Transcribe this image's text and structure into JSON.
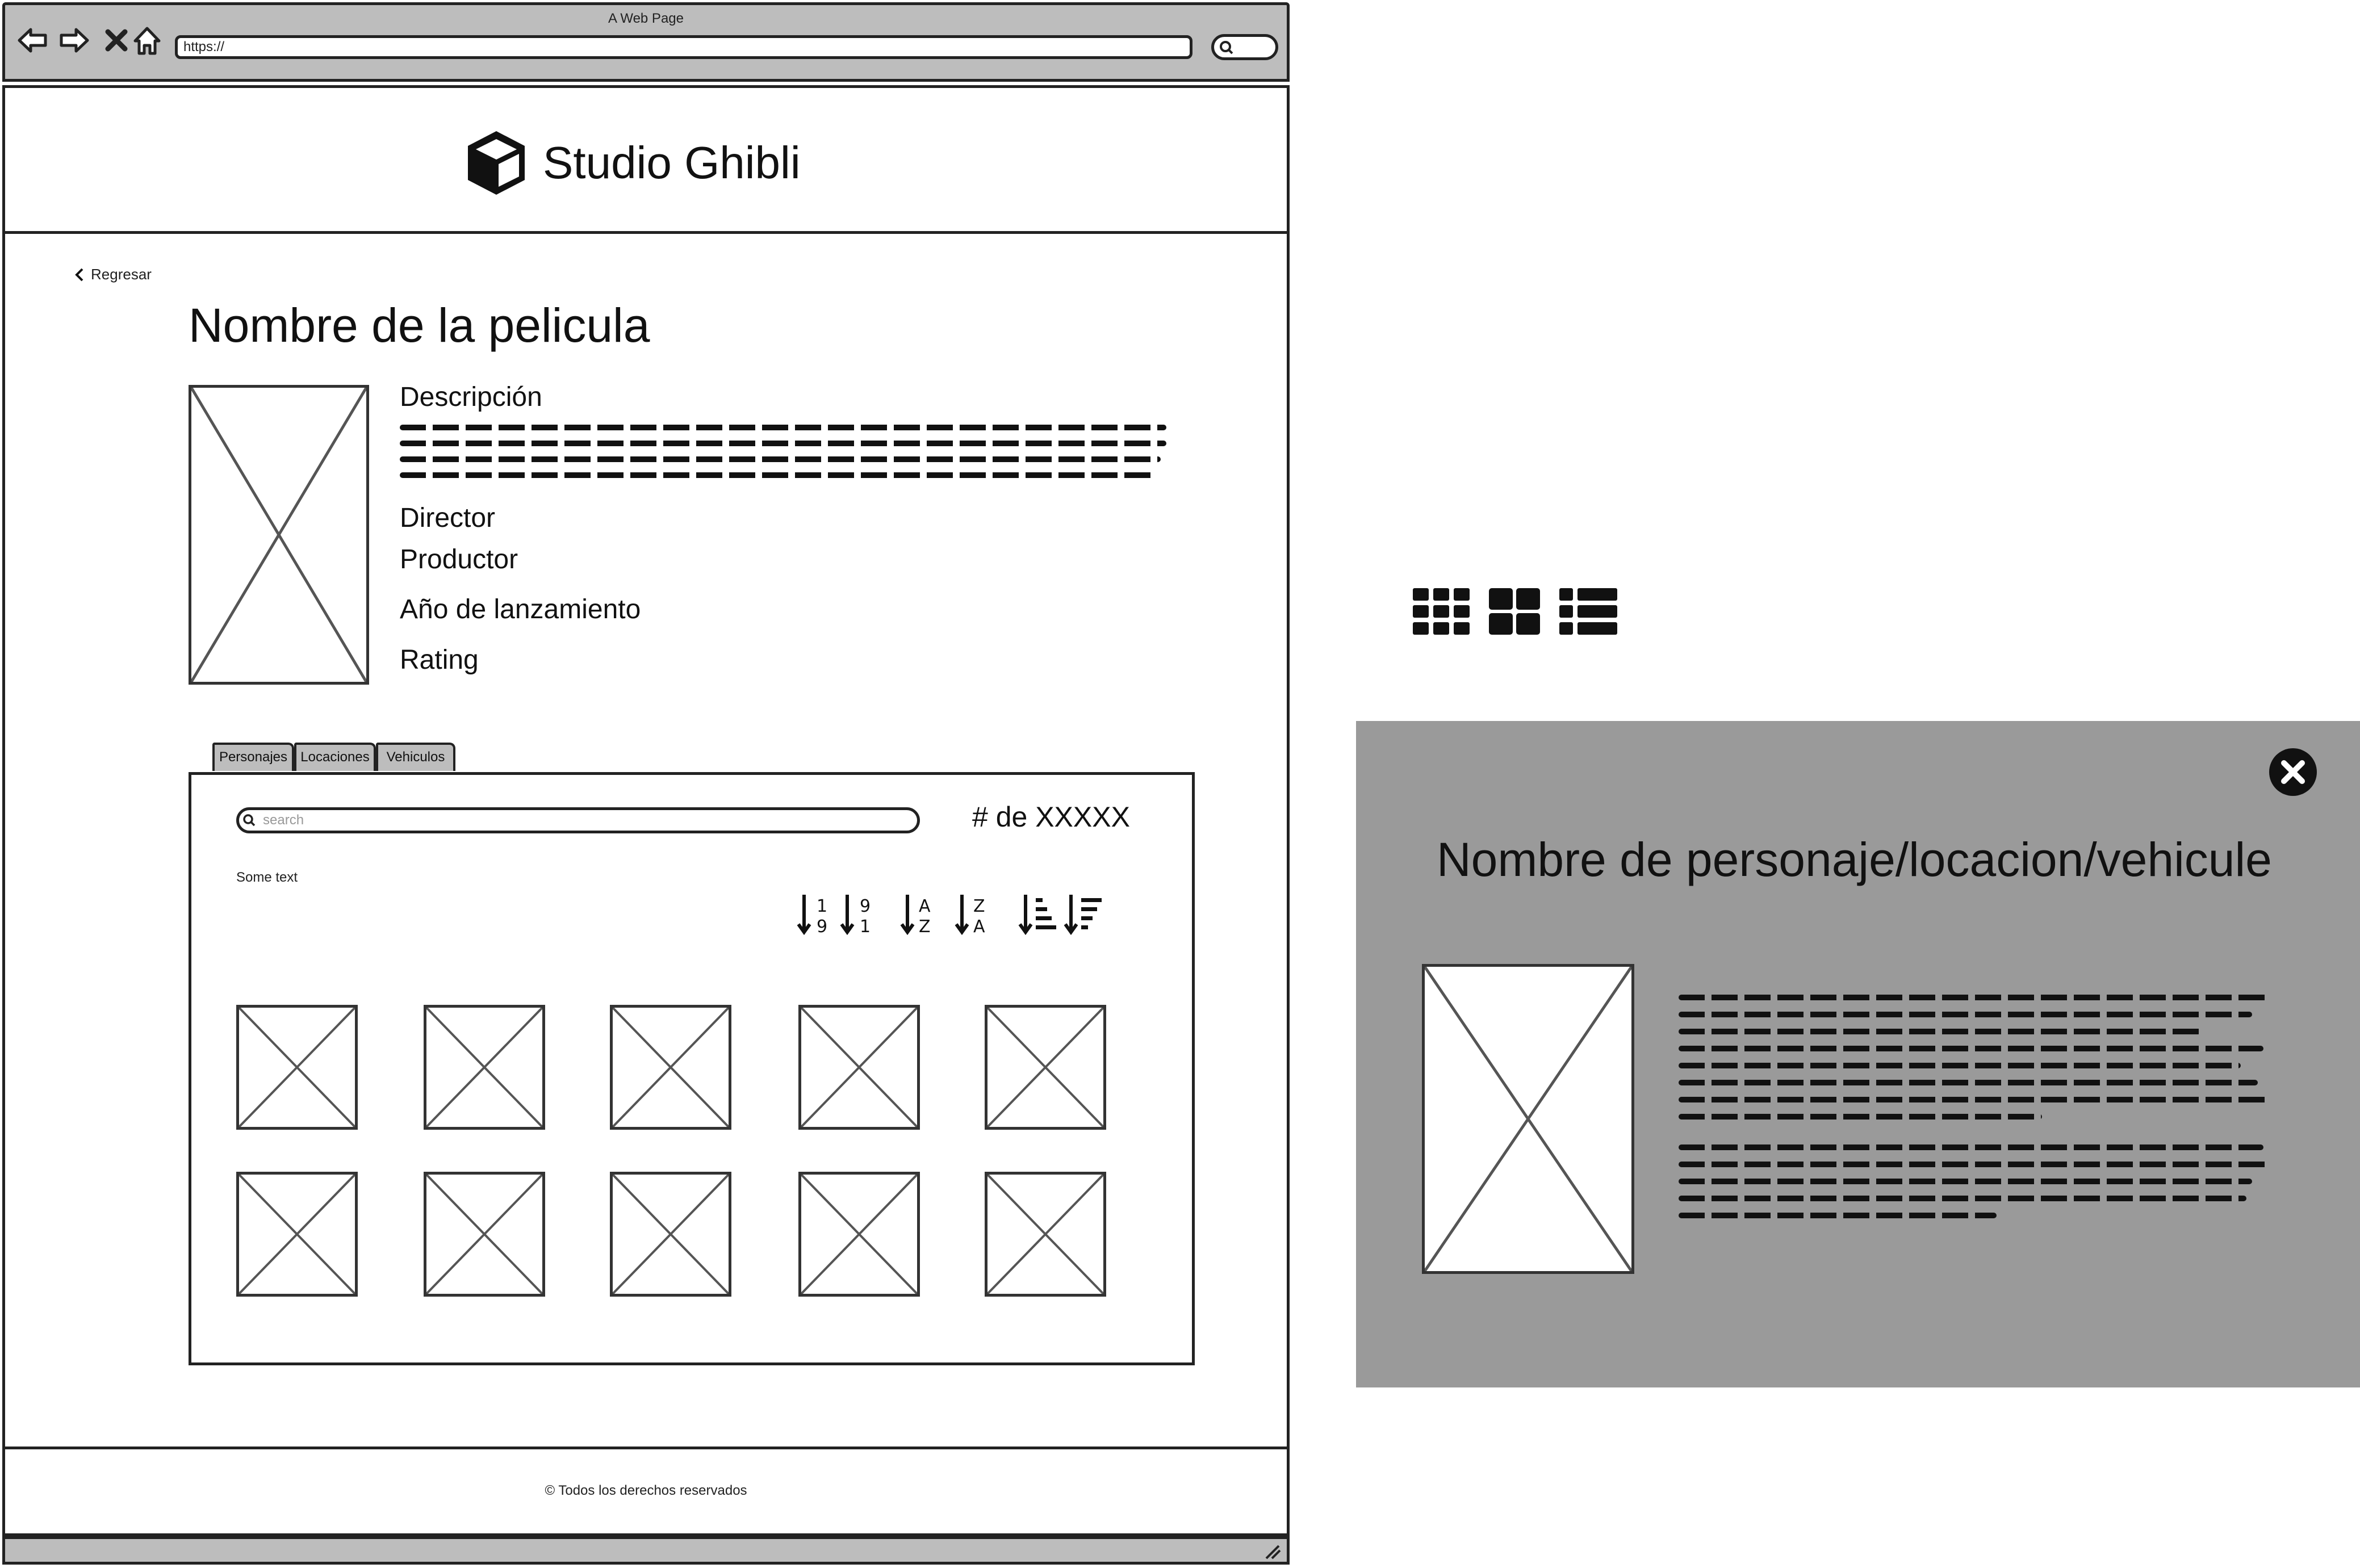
{
  "browser": {
    "window_title": "A Web Page",
    "url": "https://",
    "nav_icons": [
      "back-arrow-icon",
      "forward-arrow-icon",
      "close-icon",
      "home-icon"
    ]
  },
  "header": {
    "logo_icon": "cube-icon",
    "brand": "Studio Ghibli"
  },
  "film": {
    "back_label": "Regresar",
    "title": "Nombre de la pelicula",
    "fields": {
      "descripcion": "Descripción",
      "director": "Director",
      "productor": "Productor",
      "anio": "Año de lanzamiento",
      "rating": "Rating"
    }
  },
  "tabs": [
    "Personajes",
    "Locaciones",
    "Vehiculos"
  ],
  "panel": {
    "search_placeholder": "search",
    "count": "# de XXXXX",
    "some_text": "Some text",
    "sort_icons": [
      "sort-numeric-asc-icon",
      "sort-numeric-desc-icon",
      "sort-alpha-asc-icon",
      "sort-alpha-desc-icon",
      "sort-amount-asc-icon",
      "sort-amount-desc-icon"
    ]
  },
  "footer": {
    "text": "© Todos los derechos reservados"
  },
  "view_icons": [
    "grid-small-icon",
    "grid-large-icon",
    "list-view-icon"
  ],
  "modal": {
    "title": "Nombre de personaje/locacion/vehicule",
    "close_icon": "close-circle-icon"
  },
  "colors": {
    "chrome_gray": "#bdbdbd",
    "modal_gray": "#9a9a9a",
    "ink": "#222222"
  }
}
